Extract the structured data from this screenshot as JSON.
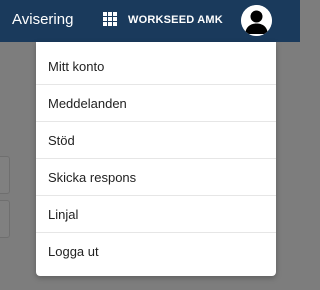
{
  "header": {
    "brand": "Avisering",
    "apps_icon": "grid-apps-icon",
    "organization": "WORKSEED AMK",
    "avatar_icon": "user-avatar-icon"
  },
  "menu": {
    "items": [
      {
        "label": "Mitt konto"
      },
      {
        "label": "Meddelanden"
      },
      {
        "label": "Stöd"
      },
      {
        "label": "Skicka respons"
      },
      {
        "label": "Linjal"
      },
      {
        "label": "Logga ut"
      }
    ]
  },
  "colors": {
    "header_bg": "#1a3a5c",
    "overlay_bg": "#7d7d7d",
    "menu_bg": "#ffffff"
  }
}
